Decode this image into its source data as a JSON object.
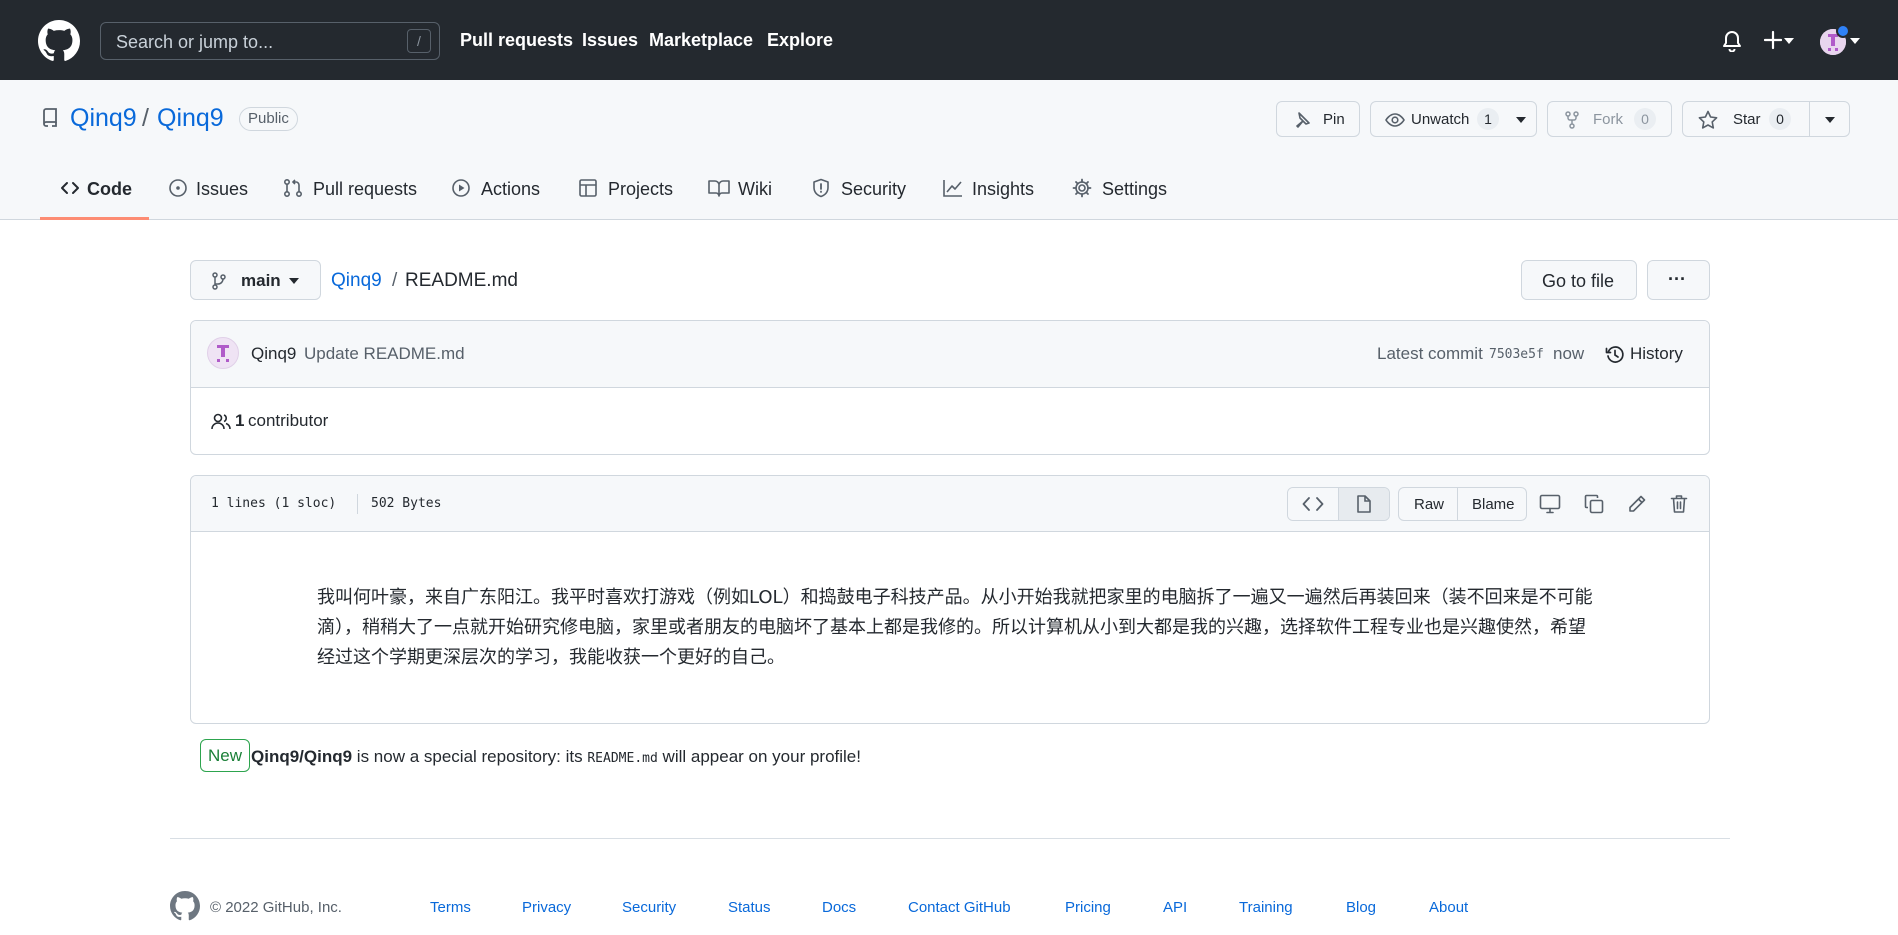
{
  "header": {
    "search_placeholder": "Search or jump to...",
    "search_key": "/",
    "nav": [
      "Pull requests",
      "Issues",
      "Marketplace",
      "Explore"
    ]
  },
  "repo": {
    "owner": "Qinq9",
    "separator": "/",
    "name": "Qinq9",
    "visibility": "Public",
    "pin_label": "Pin",
    "watch_label": "Unwatch",
    "watch_count": "1",
    "fork_label": "Fork",
    "fork_count": "0",
    "star_label": "Star",
    "star_count": "0",
    "tabs": [
      "Code",
      "Issues",
      "Pull requests",
      "Actions",
      "Projects",
      "Wiki",
      "Security",
      "Insights",
      "Settings"
    ]
  },
  "file": {
    "branch": "main",
    "breadcrumb_repo": "Qinq9",
    "breadcrumb_sep": "/",
    "filename": "README.md",
    "goto_label": "Go to file",
    "more_label": "···"
  },
  "commit": {
    "author": "Qinq9",
    "message": "Update README.md",
    "latest_label": "Latest commit",
    "sha": "7503e5f",
    "time": "now",
    "history_label": "History",
    "contributor_count": "1",
    "contributor_label": "contributor"
  },
  "viewer": {
    "lines": "1 lines (1 sloc)",
    "size": "502 Bytes",
    "raw_label": "Raw",
    "blame_label": "Blame",
    "readme_text": "我叫何叶豪，来自广东阳江。我平时喜欢打游戏（例如LOL）和捣鼓电子科技产品。从小开始我就把家里的电脑拆了一遍又一遍然后再装回来（装不回来是不可能滴），稍稍大了一点就开始研究修电脑，家里或者朋友的电脑坏了基本上都是我修的。所以计算机从小到大都是我的兴趣，选择软件工程专业也是兴趣使然，希望经过这个学期更深层次的学习，我能收获一个更好的自己。"
  },
  "notice": {
    "badge": "New",
    "repo": "Qinq9/Qinq9",
    "text_before": "is now a special repository: its",
    "code": "README.md",
    "text_after": "will appear on your profile!"
  },
  "footer": {
    "copyright": "© 2022 GitHub, Inc.",
    "links": [
      "Terms",
      "Privacy",
      "Security",
      "Status",
      "Docs",
      "Contact GitHub",
      "Pricing",
      "API",
      "Training",
      "Blog",
      "About"
    ]
  },
  "colors": {
    "header_bg": "#24292f",
    "link": "#0969da",
    "tab_underline": "#fd8c73",
    "new_badge": "#1a7f37"
  }
}
